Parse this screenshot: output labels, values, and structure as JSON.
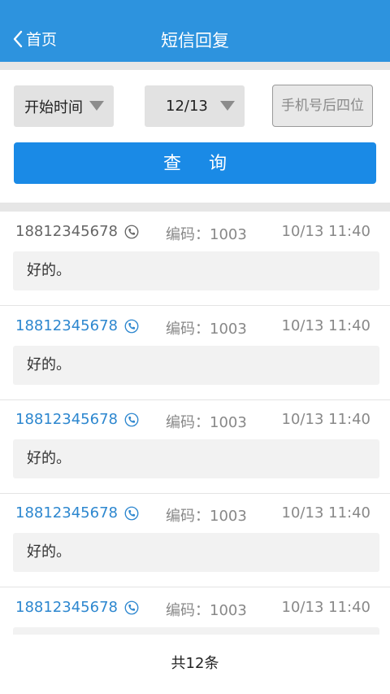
{
  "header": {
    "back_label": "首页",
    "title": "短信回复",
    "back_icon": "chevron-left-icon",
    "background": "#2d93de"
  },
  "filters": {
    "start_time_label": "开始时间",
    "date_value": "12/13",
    "phone_placeholder": "手机号后四位"
  },
  "query_button": {
    "label": "查 询",
    "color": "#1a8ae6"
  },
  "messages": [
    {
      "phone": "18812345678",
      "code": "编码：1003",
      "time": "10/13 11:40",
      "text": "好的。"
    },
    {
      "phone": "18812345678",
      "code": "编码：1003",
      "time": "10/13 11:40",
      "text": "好的。"
    },
    {
      "phone": "18812345678",
      "code": "编码：1003",
      "time": "10/13 11:40",
      "text": "好的。"
    },
    {
      "phone": "18812345678",
      "code": "编码：1003",
      "time": "10/13 11:40",
      "text": "好的。"
    },
    {
      "phone": "18812345678",
      "code": "编码：1003",
      "time": "10/13 11:40",
      "text": ""
    }
  ],
  "footer": {
    "total_label": "共12条"
  },
  "colors": {
    "link_blue": "#2d87cf",
    "gray_text": "#888888"
  }
}
